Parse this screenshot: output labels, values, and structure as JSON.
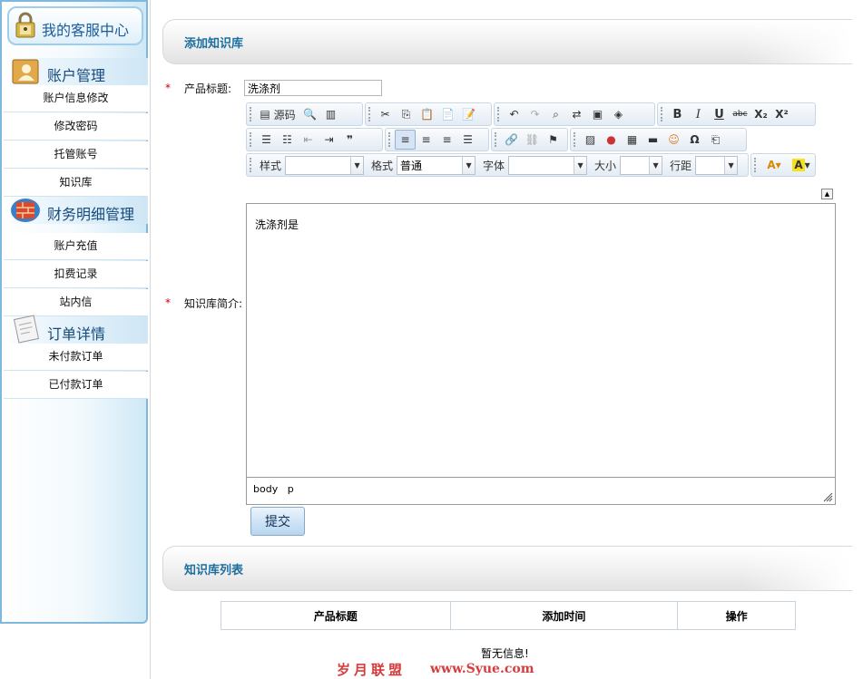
{
  "sidebar": {
    "title": "我的客服中心",
    "sections": [
      {
        "label": "账户管理",
        "items": [
          "账户信息修改",
          "修改密码",
          "托管账号",
          "知识库"
        ]
      },
      {
        "label": "财务明细管理",
        "items": [
          "账户充值",
          "扣费记录",
          "站内信"
        ]
      },
      {
        "label": "订单详情",
        "items": [
          "未付款订单",
          "已付款订单"
        ]
      }
    ]
  },
  "form": {
    "heading": "添加知识库",
    "required_mark": "*",
    "title_label": "产品标题:",
    "title_value": "洗涤剂",
    "intro_label": "知识库简介:",
    "submit_label": "提交"
  },
  "editor": {
    "toolbar": {
      "source_label": "源码",
      "style_label": "样式",
      "style_value": "",
      "format_label": "格式",
      "format_value": "普通",
      "font_label": "字体",
      "font_value": "",
      "size_label": "大小",
      "size_value": "",
      "lineheight_label": "行距",
      "lineheight_value": "",
      "bold": "B",
      "italic": "I",
      "underline": "U",
      "strike": "abc",
      "subscript": "X₂",
      "superscript": "X²",
      "special_char": "Ω",
      "quote": "❞"
    },
    "content": "洗涤剂是",
    "path_body": "body",
    "path_p": "p"
  },
  "list": {
    "heading": "知识库列表",
    "columns": [
      "产品标题",
      "添加时间",
      "操作"
    ],
    "empty_text": "暂无信息!"
  },
  "watermark": {
    "text1": "岁月联盟",
    "text2": "www.Syue.com"
  }
}
